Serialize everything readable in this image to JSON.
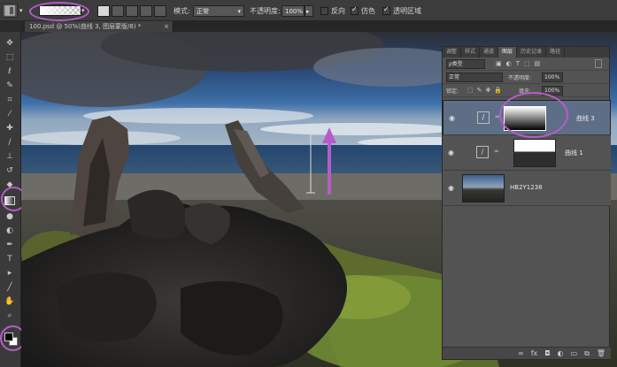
{
  "options_bar": {
    "mode_label": "模式:",
    "mode_value": "正常",
    "opacity_label": "不透明度:",
    "opacity_value": "100%",
    "reverse_label": "反向",
    "dither_label": "仿色",
    "transparency_label": "透明区域",
    "reverse_checked": false,
    "dither_checked": true,
    "transparency_checked": true
  },
  "document_tab": {
    "label": "100.psd @ 50%(曲线 3, 图层蒙版/8) *"
  },
  "layers_panel": {
    "tabs": [
      "调整",
      "样式",
      "通道",
      "图层",
      "历史记录",
      "路径"
    ],
    "active_tab": "图层",
    "filter_label": "ρ类型",
    "blend_mode": "正常",
    "opacity_label": "不透明度:",
    "opacity_value": "100%",
    "lock_label": "锁定:",
    "fill_label": "填充:",
    "fill_value": "100%",
    "layers": [
      {
        "name": "曲线 3",
        "selected": true
      },
      {
        "name": "曲线 1",
        "selected": false
      },
      {
        "name": "HB2Y1238",
        "selected": false
      }
    ]
  },
  "colors": {
    "highlight": "#b65cc9",
    "selected_layer": "#5f6e87"
  }
}
